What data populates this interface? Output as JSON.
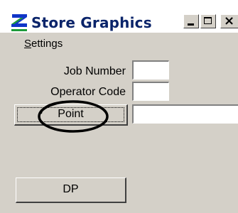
{
  "window": {
    "title": "Store Graphics",
    "icon": "s-logo-icon",
    "controls": [
      "minimize",
      "maximize",
      "close"
    ]
  },
  "menu": {
    "settings_label": "Settings",
    "settings_mnemonic": "S",
    "settings_rest": "ettings"
  },
  "form": {
    "job_number_label": "Job Number",
    "job_number_value": "",
    "operator_code_label": "Operator Code",
    "operator_code_value": "",
    "point_button_label": "Point",
    "point_value": "",
    "dp_button_label": "DP"
  },
  "colors": {
    "face": "#d4d0c8",
    "title_text": "#0a246a",
    "logo_blue": "#1035c8",
    "logo_green": "#1d9b3a",
    "annotation": "#000000"
  }
}
